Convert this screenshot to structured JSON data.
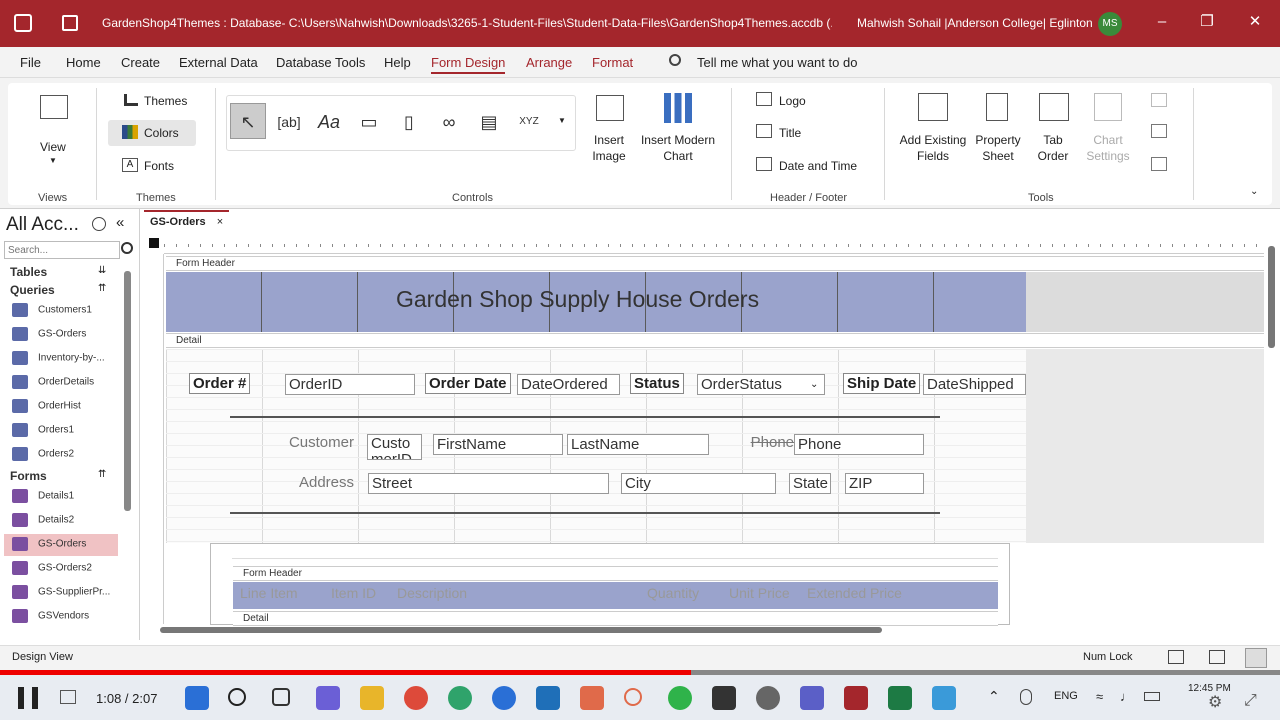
{
  "title_bar": {
    "title": "GardenShop4Themes : Database- C:\\Users\\Nahwish\\Downloads\\3265-1-Student-Files\\Student-Data-Files\\GardenShop4Themes.accdb (...",
    "user": "Mahwish Sohail |Anderson College| Eglinton",
    "avatar": "MS"
  },
  "menu_tabs": [
    "File",
    "Home",
    "Create",
    "External Data",
    "Database Tools",
    "Help",
    "Form Design",
    "Arrange",
    "Format"
  ],
  "tell_me": "Tell me what you want to do",
  "ribbon": {
    "view": "View",
    "views_group": "Views",
    "themes": "Themes",
    "colors": "Colors",
    "fonts": "Fonts",
    "themes_group": "Themes",
    "controls_group": "Controls",
    "insert_image": "Insert Image",
    "insert_chart": "Insert Modern Chart",
    "logo": "Logo",
    "title": "Title",
    "date_time": "Date and Time",
    "header_footer_group": "Header / Footer",
    "add_fields": "Add Existing Fields",
    "property_sheet": "Property Sheet",
    "tab_order": "Tab Order",
    "chart_settings": "Chart Settings",
    "tools_group": "Tools"
  },
  "nav": {
    "title": "All Acc...",
    "search_placeholder": "Search...",
    "tables": "Tables",
    "queries": "Queries",
    "query_items": [
      "Customers1",
      "GS-Orders",
      "Inventory-by-...",
      "OrderDetails",
      "OrderHist",
      "Orders1",
      "Orders2"
    ],
    "forms": "Forms",
    "form_items": [
      "Details1",
      "Details2",
      "GS-Orders",
      "GS-Orders2",
      "GS-SupplierPr...",
      "GSVendors"
    ]
  },
  "doc_tab": "GS-Orders",
  "form": {
    "header_section": "Form Header",
    "title": "Garden Shop Supply House Orders",
    "detail_section": "Detail",
    "order_label": "Order #",
    "order_id": "OrderID",
    "order_date_label": "Order Date",
    "date_ordered": "DateOrdered",
    "status_label": "Status",
    "order_status": "OrderStatus",
    "ship_date_label": "Ship Date",
    "date_shipped": "DateShipped",
    "customer_label": "Customer",
    "customer_id": "Custo merID",
    "first_name": "FirstName",
    "last_name": "LastName",
    "phone_label": "Phone",
    "phone": "Phone",
    "address_label": "Address",
    "street": "Street",
    "city": "City",
    "state": "State",
    "zip": "ZIP",
    "sub_header": "Form Header",
    "sub_detail": "Detail",
    "sub_cols": [
      "Line Item",
      "Item ID",
      "Description",
      "Quantity",
      "Unit Price",
      "Extended Price"
    ]
  },
  "status": {
    "left": "Design View",
    "numlock": "Num Lock"
  },
  "video": {
    "time": "1:08 / 2:07",
    "progress_fraction": 0.54
  },
  "clock": {
    "time": "12:45 PM",
    "lang": "ENG"
  }
}
